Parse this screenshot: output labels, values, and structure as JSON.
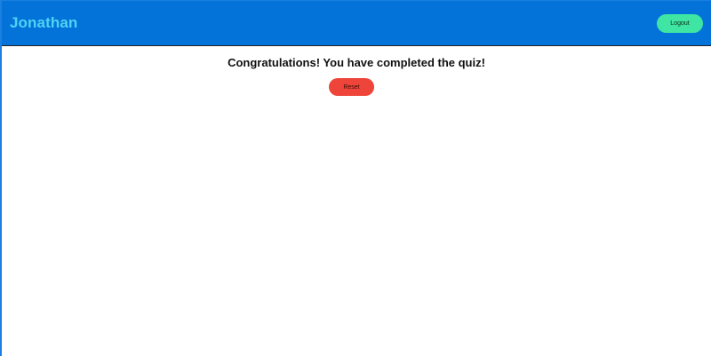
{
  "header": {
    "username": "Jonathan",
    "logout_label": "Logout"
  },
  "main": {
    "message": "Congratulations! You have completed the quiz!",
    "reset_label": "Reset"
  },
  "colors": {
    "header_bg": "#0473d9",
    "username_text": "#4fd3f5",
    "logout_button": "#3fe6a3",
    "reset_button": "#ee4439"
  }
}
